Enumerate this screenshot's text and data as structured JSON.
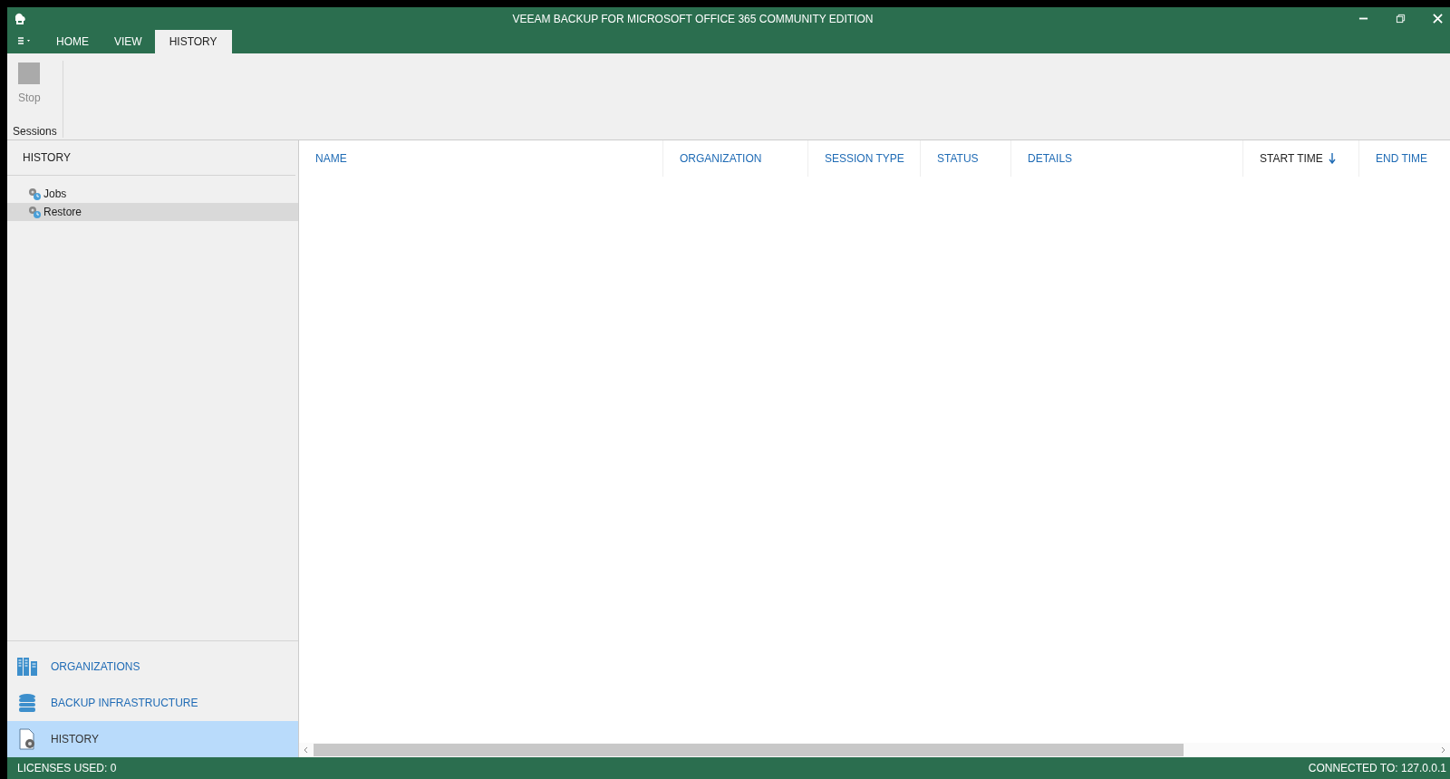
{
  "window": {
    "title": "VEEAM BACKUP FOR MICROSOFT OFFICE 365 COMMUNITY EDITION"
  },
  "ribbon_tabs": [
    {
      "label": "HOME",
      "selected": false
    },
    {
      "label": "VIEW",
      "selected": false
    },
    {
      "label": "HISTORY",
      "selected": true
    }
  ],
  "ribbon": {
    "groups": [
      {
        "label": "Sessions",
        "buttons": [
          {
            "label": "Stop",
            "disabled": true
          }
        ]
      }
    ]
  },
  "sidebar": {
    "title": "HISTORY",
    "tree": [
      {
        "label": "Jobs",
        "selected": false
      },
      {
        "label": "Restore",
        "selected": true
      }
    ],
    "nav": [
      {
        "label": "ORGANIZATIONS",
        "kind": "organizations",
        "selected": false
      },
      {
        "label": "BACKUP INFRASTRUCTURE",
        "kind": "infrastructure",
        "selected": false
      },
      {
        "label": "HISTORY",
        "kind": "history",
        "selected": true
      }
    ]
  },
  "table": {
    "columns": [
      {
        "label": "NAME",
        "sorted": false
      },
      {
        "label": "ORGANIZATION",
        "sorted": false
      },
      {
        "label": "SESSION TYPE",
        "sorted": false
      },
      {
        "label": "STATUS",
        "sorted": false
      },
      {
        "label": "DETAILS",
        "sorted": false
      },
      {
        "label": "START TIME",
        "sorted": true
      },
      {
        "label": "END TIME",
        "sorted": false
      }
    ]
  },
  "status_bar": {
    "left": "LICENSES USED: 0",
    "right": "CONNECTED TO: 127.0.0.1"
  }
}
